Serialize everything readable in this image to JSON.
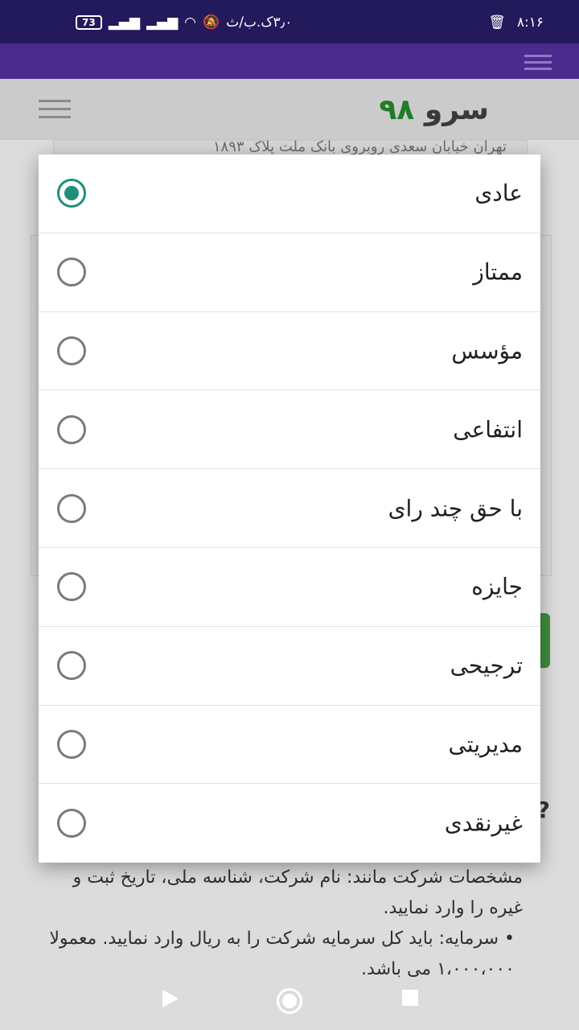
{
  "status_bar": {
    "battery": "73",
    "speed": "۳٫۰ک.ب/ث",
    "time": "۸:۱۶",
    "icons": [
      "battery-icon",
      "signal-icon",
      "signal-icon",
      "wifi-icon",
      "mute-icon",
      "trash-icon"
    ]
  },
  "header": {
    "logo_text": "سرو",
    "logo_number": "۹۸"
  },
  "background": {
    "address": "تهران خیابان سعدی روبروی بانک ملت پلاک ۱۸۹۳",
    "question_mark": "?",
    "paragraph1": "مشخصات شرکت مانند: نام شرکت، شناسه ملی، تاریخ ثبت و غیره را وارد نمایید.",
    "bullet": "•",
    "paragraph2": "سرمایه: باید کل سرمایه شرکت را به ریال وارد نمایید. معمولا ۱،۰۰۰،۰۰۰ می باشد."
  },
  "dialog": {
    "options": [
      {
        "label": "عادی",
        "selected": true
      },
      {
        "label": "ممتاز",
        "selected": false
      },
      {
        "label": "مؤسس",
        "selected": false
      },
      {
        "label": "انتفاعی",
        "selected": false
      },
      {
        "label": "با حق چند رای",
        "selected": false
      },
      {
        "label": "جایزه",
        "selected": false
      },
      {
        "label": "ترجیحی",
        "selected": false
      },
      {
        "label": "مدیریتی",
        "selected": false
      },
      {
        "label": "غیرنقدی",
        "selected": false
      }
    ]
  },
  "colors": {
    "status_bar": "#231a5c",
    "top_bar": "#4b2b8d",
    "radio_checked": "#1f8f7a",
    "logo_number": "#1f7d28"
  }
}
